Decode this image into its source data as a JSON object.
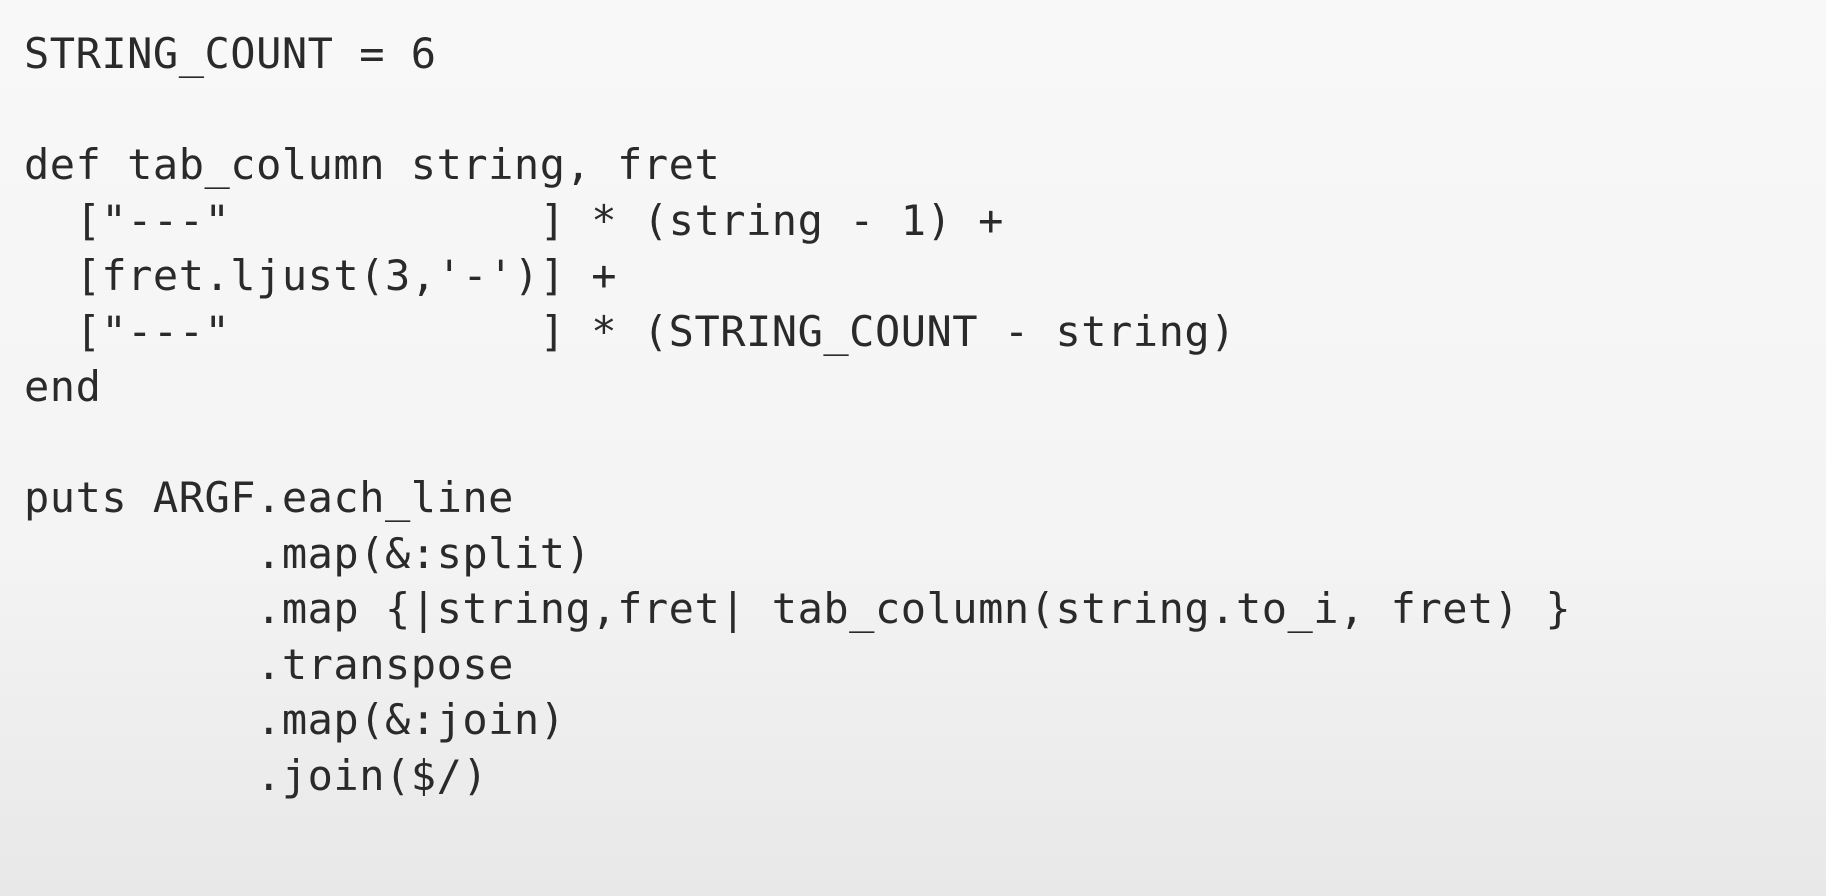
{
  "code": {
    "lines": [
      "STRING_COUNT = 6",
      "",
      "def tab_column string, fret",
      "  [\"---\"            ] * (string - 1) +",
      "  [fret.ljust(3,'-')] +",
      "  [\"---\"            ] * (STRING_COUNT - string)",
      "end",
      "",
      "puts ARGF.each_line",
      "         .map(&:split)",
      "         .map {|string,fret| tab_column(string.to_i, fret) }",
      "         .transpose",
      "         .map(&:join)",
      "         .join($/)"
    ]
  }
}
